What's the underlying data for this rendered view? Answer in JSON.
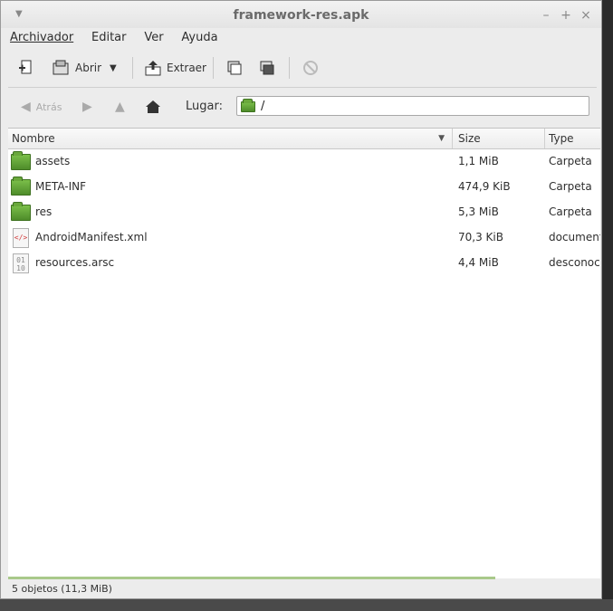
{
  "window": {
    "title": "framework-res.apk"
  },
  "menu": {
    "archivador": "Archivador",
    "editar": "Editar",
    "ver": "Ver",
    "ayuda": "Ayuda"
  },
  "toolbar": {
    "abrir": "Abrir",
    "extraer": "Extraer"
  },
  "nav": {
    "atras": "Atrás",
    "lugar_label": "Lugar:",
    "lugar_value": "/"
  },
  "columns": {
    "name": "Nombre",
    "size": "Size",
    "type": "Type"
  },
  "files": [
    {
      "name": "assets",
      "size": "1,1 MiB",
      "type": "Carpeta",
      "icon": "folder-icon"
    },
    {
      "name": "META-INF",
      "size": "474,9 KiB",
      "type": "Carpeta",
      "icon": "folder-icon"
    },
    {
      "name": "res",
      "size": "5,3 MiB",
      "type": "Carpeta",
      "icon": "folder-icon"
    },
    {
      "name": "AndroidManifest.xml",
      "size": "70,3 KiB",
      "type": "documento XML",
      "icon": "xml-file-icon"
    },
    {
      "name": "resources.arsc",
      "size": "4,4 MiB",
      "type": "desconocido",
      "icon": "binary-file-icon"
    }
  ],
  "status": {
    "text": "5 objetos (11,3 MiB)"
  },
  "colors": {
    "folder": "#5a9a32",
    "progress": "#a9c98a"
  }
}
